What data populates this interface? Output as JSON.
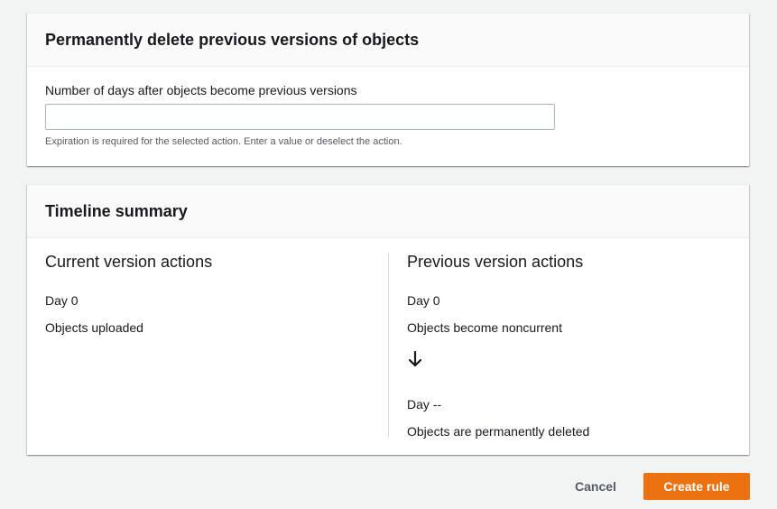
{
  "delete_panel": {
    "title": "Permanently delete previous versions of objects",
    "field_label": "Number of days after objects become previous versions",
    "field_value": "",
    "field_placeholder": "",
    "help_text": "Expiration is required for the selected action. Enter a value or deselect the action."
  },
  "timeline_panel": {
    "title": "Timeline summary",
    "current": {
      "title": "Current version actions",
      "day": "Day 0",
      "event": "Objects uploaded"
    },
    "previous": {
      "title": "Previous version actions",
      "day_start": "Day 0",
      "event_start": "Objects become noncurrent",
      "arrow_icon": "arrow-down-icon",
      "day_end": "Day --",
      "event_end": "Objects are permanently deleted"
    }
  },
  "actions": {
    "cancel_label": "Cancel",
    "create_label": "Create rule"
  },
  "colors": {
    "primary_button": "#ec7211",
    "page_background": "#f2f3f3",
    "text": "#16191f",
    "secondary_text": "#545b64"
  }
}
